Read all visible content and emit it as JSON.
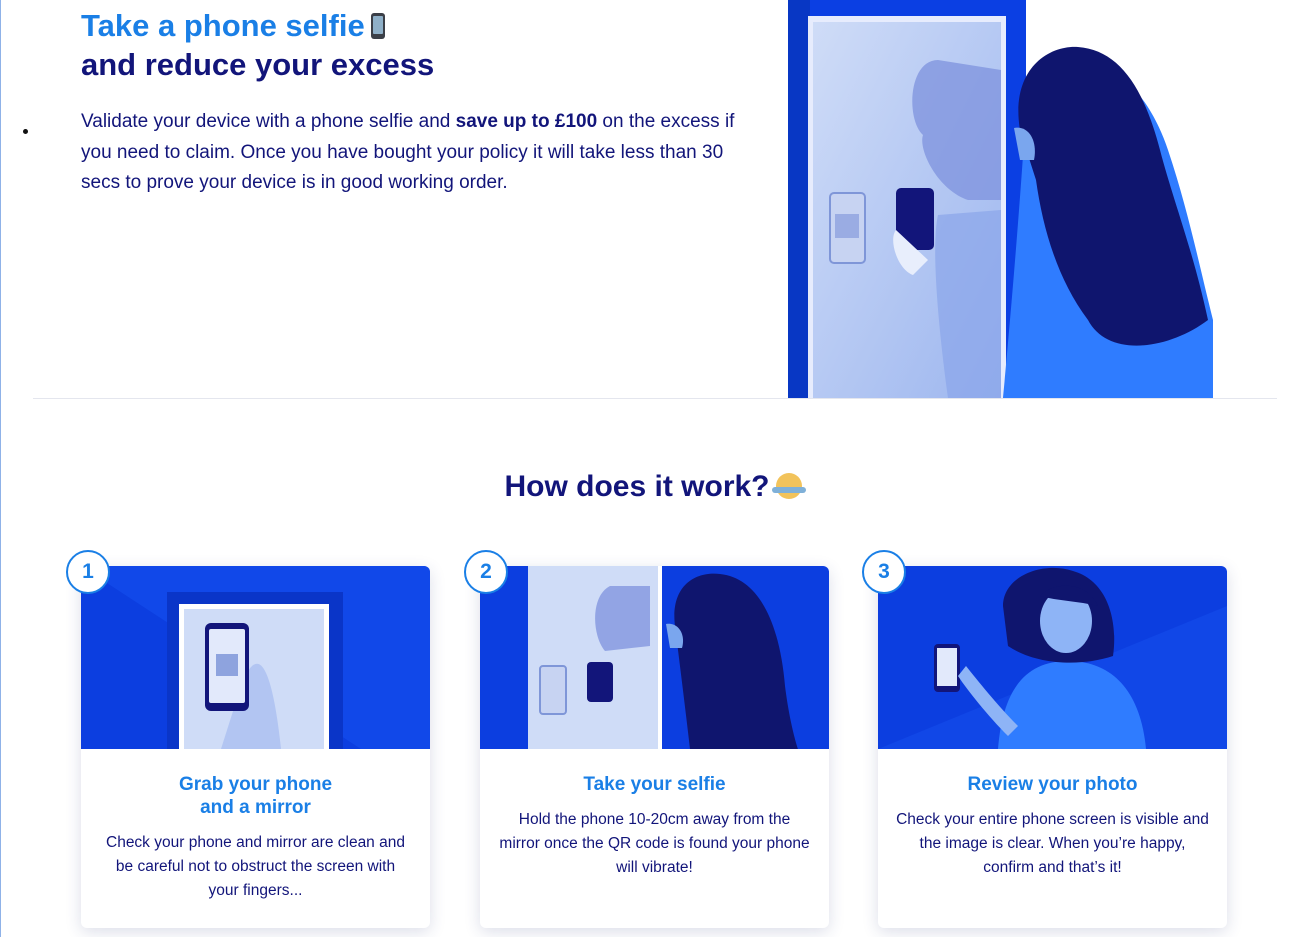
{
  "hero": {
    "title_line1": "Take a phone selfie",
    "title_line2": "and reduce your excess",
    "title_emoji": "mobile-phone-icon",
    "text_before": "Validate your device with a phone selfie and ",
    "text_bold": "save up to £100",
    "text_after": " on the excess if you need to claim. Once you have bought your policy it will take less than 30 secs to prove your device is in good working order."
  },
  "how": {
    "title": "How does it work?",
    "title_emoji": "person-shrugging-icon"
  },
  "steps": [
    {
      "number": "1",
      "title_line1": "Grab your phone",
      "title_line2": "and a mirror",
      "description": "Check your phone and mirror are clean and be careful not to obstruct the screen with your fingers..."
    },
    {
      "number": "2",
      "title_line1": "Take your selfie",
      "title_line2": "",
      "description": "Hold the phone 10-20cm away from the mirror once the QR code is found your phone will vibrate!"
    },
    {
      "number": "3",
      "title_line1": "Review your photo",
      "title_line2": "",
      "description": "Check your entire phone screen is visible and the image is clear. When you’re happy, confirm and that’s it!"
    }
  ],
  "colors": {
    "brand_blue": "#1a7fe6",
    "navy": "#12157a",
    "illustration_blue": "#0c3ee0"
  }
}
